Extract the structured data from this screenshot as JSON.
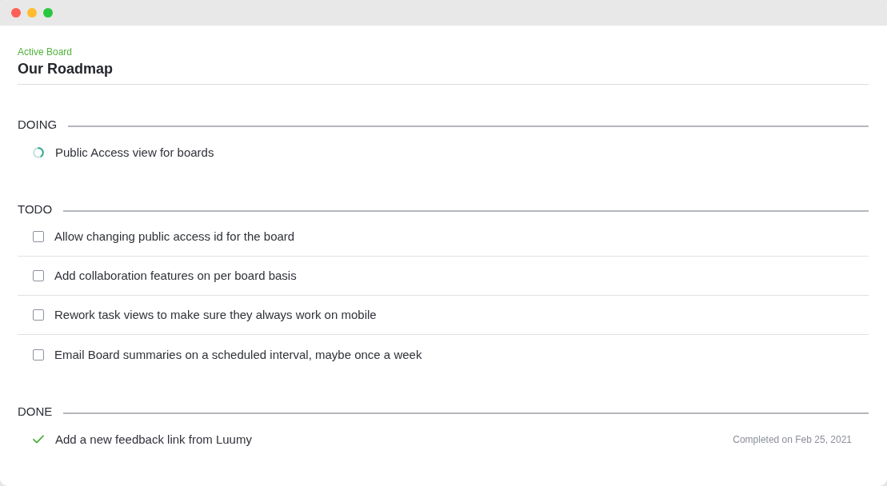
{
  "board": {
    "label": "Active Board",
    "title": "Our Roadmap"
  },
  "sections": [
    {
      "title": "DOING",
      "tasks": [
        {
          "kind": "doing",
          "text": "Public Access view for boards"
        }
      ]
    },
    {
      "title": "TODO",
      "tasks": [
        {
          "kind": "todo",
          "text": "Allow changing public access id for the board"
        },
        {
          "kind": "todo",
          "text": "Add collaboration features on per board basis"
        },
        {
          "kind": "todo",
          "text": "Rework task views to make sure they always work on mobile"
        },
        {
          "kind": "todo",
          "text": "Email Board summaries on a scheduled interval, maybe once a week"
        }
      ]
    },
    {
      "title": "DONE",
      "tasks": [
        {
          "kind": "done",
          "text": "Add a new feedback link from Luumy",
          "completed_note": "Completed on Feb 25, 2021"
        }
      ]
    }
  ]
}
